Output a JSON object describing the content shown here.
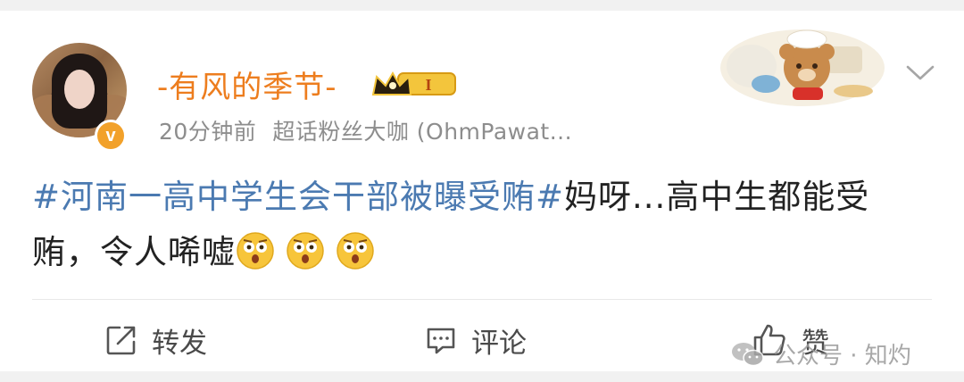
{
  "post": {
    "username": "-有风的季节-",
    "level_badge": "I",
    "time": "20分钟前",
    "source": "超话粉丝大咖 (OhmPawat...",
    "verified_mark": "v",
    "hashtag": "#河南一高中学生会干部被曝受贿#",
    "text": "妈呀...高中生都能受贿，令人唏嘘"
  },
  "actions": {
    "repost": "转发",
    "comment": "评论",
    "like": "赞"
  },
  "watermark": "公众号 · 知灼",
  "icons": [
    "crown-badge-icon",
    "expand-chevron-icon",
    "repost-icon",
    "comment-icon",
    "like-icon",
    "astonished-emoji-icon",
    "wechat-icon"
  ],
  "colors": {
    "username": "#ed7d1e",
    "hashtag": "#4b7ab1",
    "meta": "#8d8d8d",
    "verified": "#f2a12a"
  }
}
